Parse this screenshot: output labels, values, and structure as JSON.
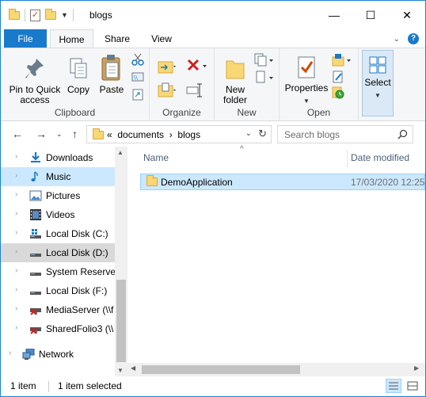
{
  "window": {
    "title": "blogs",
    "minimize": "—",
    "maximize": "☐",
    "close": "✕"
  },
  "ribbon_tabs": {
    "file": "File",
    "home": "Home",
    "share": "Share",
    "view": "View"
  },
  "ribbon": {
    "clipboard": {
      "label": "Clipboard",
      "pin": "Pin to Quick access",
      "copy": "Copy",
      "paste": "Paste"
    },
    "organize": {
      "label": "Organize"
    },
    "new": {
      "label": "New",
      "new_folder": "New folder"
    },
    "open": {
      "label": "Open",
      "properties": "Properties"
    },
    "select": {
      "label": "Select"
    }
  },
  "address": {
    "prefix": "«",
    "crumbs": [
      "documents",
      "blogs"
    ],
    "separator": "›"
  },
  "search": {
    "placeholder": "Search blogs"
  },
  "nav": {
    "items": [
      {
        "label": "Downloads",
        "icon": "download-icon"
      },
      {
        "label": "Music",
        "icon": "music-icon"
      },
      {
        "label": "Pictures",
        "icon": "pictures-icon"
      },
      {
        "label": "Videos",
        "icon": "videos-icon"
      },
      {
        "label": "Local Disk (C:)",
        "icon": "drive-icon"
      },
      {
        "label": "Local Disk (D:)",
        "icon": "drive-icon"
      },
      {
        "label": "System Reserved",
        "icon": "drive-icon"
      },
      {
        "label": "Local Disk (F:)",
        "icon": "drive-icon"
      },
      {
        "label": "MediaServer (\\\\f",
        "icon": "network-drive-disconnected-icon"
      },
      {
        "label": "SharedFolio3 (\\\\",
        "icon": "network-drive-disconnected-icon"
      },
      {
        "label": "Network",
        "icon": "network-icon"
      }
    ]
  },
  "files": {
    "columns": {
      "name": "Name",
      "date": "Date modified"
    },
    "rows": [
      {
        "name": "DemoApplication",
        "date": "17/03/2020 12:25"
      }
    ]
  },
  "status": {
    "count": "1 item",
    "selected": "1 item selected"
  },
  "colors": {
    "accent": "#1979ca",
    "selection": "#cce8ff",
    "folder": "#f8d775"
  }
}
